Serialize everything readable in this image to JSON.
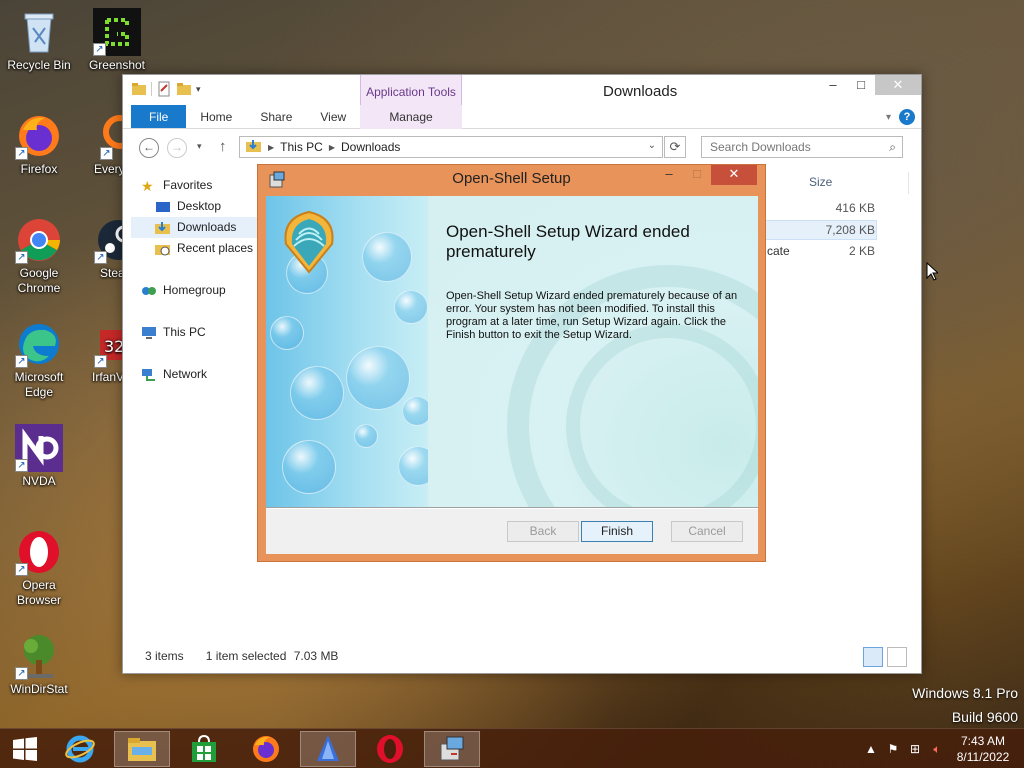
{
  "desktop": {
    "icons": [
      {
        "label": "Recycle Bin",
        "icon": "recycle-bin-icon"
      },
      {
        "label": "Greenshot",
        "icon": "greenshot-icon"
      },
      {
        "label": "Firefox",
        "icon": "firefox-icon"
      },
      {
        "label": "Everyt",
        "icon": "everything-icon"
      },
      {
        "label": "Google Chrome",
        "icon": "chrome-icon"
      },
      {
        "label": "Stea",
        "icon": "steam-icon"
      },
      {
        "label": "Microsoft Edge",
        "icon": "edge-icon"
      },
      {
        "label": "IrfanV",
        "icon": "irfanview-icon"
      },
      {
        "label": "NVDA",
        "icon": "nvda-icon"
      },
      {
        "label": "Opera Browser",
        "icon": "opera-icon"
      },
      {
        "label": "WinDirStat",
        "icon": "windirstat-icon"
      }
    ],
    "watermark": {
      "line1": "Windows 8.1 Pro",
      "line2": "Build 9600"
    }
  },
  "explorer": {
    "title": "Downloads",
    "contextual_group": "Application Tools",
    "tabs": [
      "File",
      "Home",
      "Share",
      "View",
      "Manage"
    ],
    "breadcrumb": [
      "This PC",
      "Downloads"
    ],
    "search_placeholder": "Search Downloads",
    "nav": {
      "favorites": "Favorites",
      "desktop": "Desktop",
      "downloads": "Downloads",
      "recent": "Recent places",
      "homegroup": "Homegroup",
      "thispc": "This PC",
      "network": "Network"
    },
    "column_size": "Size",
    "rows": [
      {
        "name_fragment": "",
        "size": "416 KB"
      },
      {
        "name_fragment": "",
        "size": "7,208 KB"
      },
      {
        "name_fragment": "cate",
        "size": "2 KB"
      }
    ],
    "status": {
      "items": "3 items",
      "selected": "1 item selected",
      "selected_size": "7.03 MB"
    }
  },
  "setup": {
    "title": "Open-Shell Setup",
    "headline": "Open-Shell Setup Wizard ended prematurely",
    "body": "Open-Shell Setup Wizard ended prematurely because of an error. Your system has not been modified. To install this program at a later time, run Setup Wizard again. Click the Finish button to exit the Setup Wizard.",
    "buttons": {
      "back": "Back",
      "finish": "Finish",
      "cancel": "Cancel"
    }
  },
  "taskbar": {
    "clock_time": "7:43 AM",
    "clock_date": "8/11/2022",
    "pinned": [
      "start-icon",
      "internet-explorer-icon",
      "file-explorer-icon",
      "store-icon",
      "firefox-icon",
      "open-shell-icon",
      "opera-icon",
      "setup-installer-icon"
    ]
  }
}
